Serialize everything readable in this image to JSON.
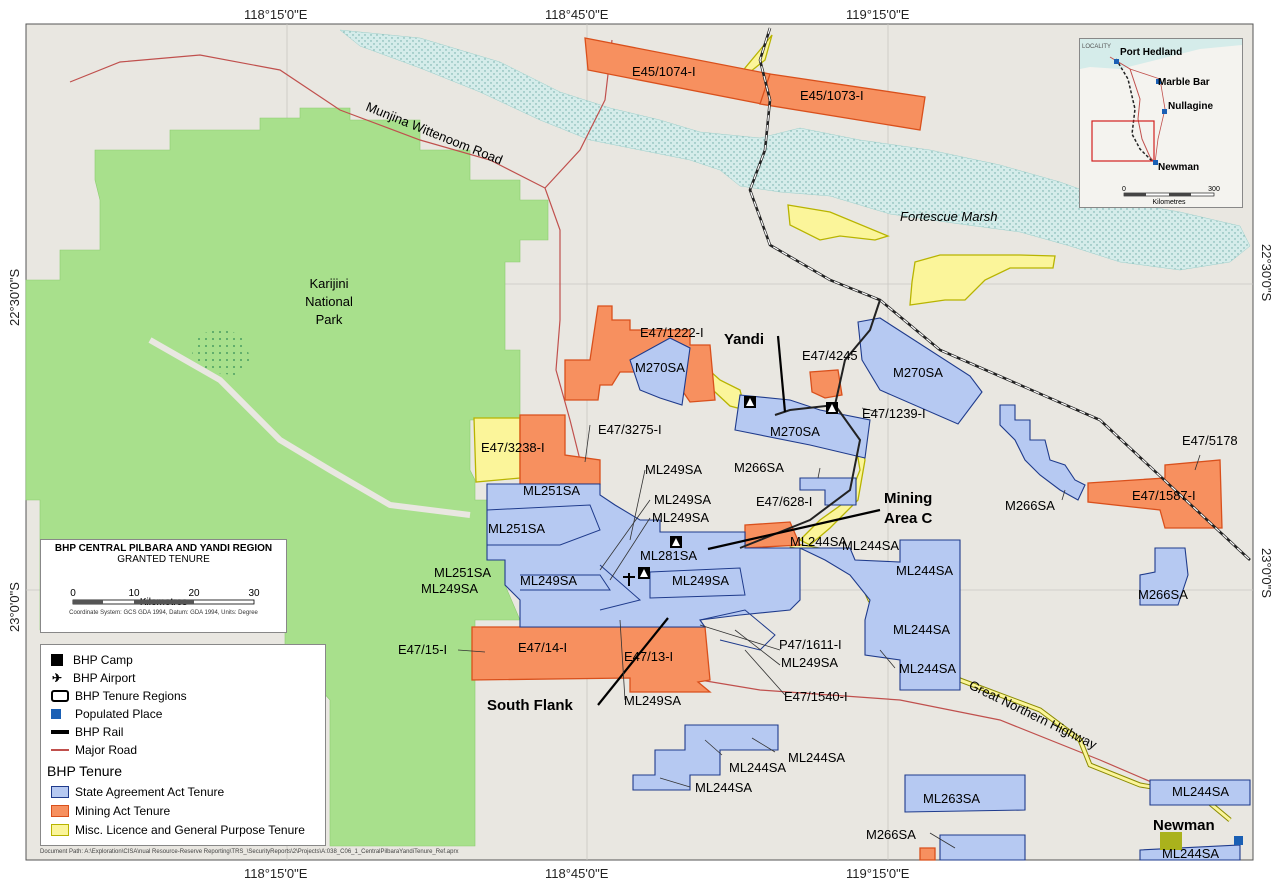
{
  "coords": {
    "top": [
      "118°15'0\"E",
      "118°45'0\"E",
      "119°15'0\"E"
    ],
    "bottom": [
      "118°15'0\"E",
      "118°45'0\"E",
      "119°15'0\"E"
    ],
    "left": [
      "22°30'0\"S",
      "23°0'0\"S"
    ],
    "right": [
      "22°30'0\"S",
      "23°0'0\"S"
    ]
  },
  "labels": {
    "karijini": [
      "Karijini",
      "National",
      "Park"
    ],
    "munjina_road": "Munjina Wittenoom Road",
    "fortescue": "Fortescue Marsh",
    "great_northern": "Great Northern Highway",
    "yandi": "Yandi",
    "mining_area_c": [
      "Mining",
      "Area C"
    ],
    "south_flank": "South Flank",
    "newman": "Newman"
  },
  "tenures": [
    {
      "text": "E45/1074-I"
    },
    {
      "text": "E45/1073-I"
    },
    {
      "text": "E47/1222-I"
    },
    {
      "text": "M270SA"
    },
    {
      "text": "E47/4245"
    },
    {
      "text": "M270SA"
    },
    {
      "text": "E47/1239-I"
    },
    {
      "text": "M270SA"
    },
    {
      "text": "E47/3275-I"
    },
    {
      "text": "E47/3238-I"
    },
    {
      "text": "ML249SA"
    },
    {
      "text": "M266SA"
    },
    {
      "text": "ML251SA"
    },
    {
      "text": "ML249SA"
    },
    {
      "text": "ML249SA"
    },
    {
      "text": "E47/628-I"
    },
    {
      "text": "ML251SA"
    },
    {
      "text": "ML281SA"
    },
    {
      "text": "ML244SA"
    },
    {
      "text": "ML244SA"
    },
    {
      "text": "ML251SA"
    },
    {
      "text": "ML249SA"
    },
    {
      "text": "ML249SA"
    },
    {
      "text": "ML249SA"
    },
    {
      "text": "ML244SA"
    },
    {
      "text": "ML244SA"
    },
    {
      "text": "E47/15-I"
    },
    {
      "text": "E47/14-I"
    },
    {
      "text": "E47/13-I"
    },
    {
      "text": "P47/1611-I"
    },
    {
      "text": "ML249SA"
    },
    {
      "text": "ML244SA"
    },
    {
      "text": "ML249SA"
    },
    {
      "text": "E47/1540-I"
    },
    {
      "text": "ML244SA"
    },
    {
      "text": "ML244SA"
    },
    {
      "text": "ML244SA"
    },
    {
      "text": "ML263SA"
    },
    {
      "text": "M266SA"
    },
    {
      "text": "ML244SA"
    },
    {
      "text": "ML244SA"
    },
    {
      "text": "E47/5178"
    },
    {
      "text": "E47/1587-I"
    },
    {
      "text": "M266SA"
    },
    {
      "text": "M266SA"
    }
  ],
  "title_box": {
    "title": "BHP CENTRAL PILBARA AND YANDI REGION",
    "subtitle": "GRANTED TENURE",
    "scale_ticks": [
      "0",
      "10",
      "20",
      "30"
    ],
    "scale_unit": "Kilometres",
    "crs": "Coordinate System: GCS GDA 1994, Datum: GDA 1994, Units: Degree"
  },
  "legend": {
    "items": [
      "BHP Camp",
      "BHP Airport",
      "BHP Tenure Regions",
      "Populated Place",
      "BHP Rail",
      "Major Road"
    ],
    "tenure_heading": "BHP Tenure",
    "tenure_items": [
      "State Agreement Act Tenure",
      "Mining Act Tenure",
      "Misc. Licence and General Purpose Tenure"
    ]
  },
  "inset": {
    "locality": "LOCALITY",
    "places": [
      "Port Hedland",
      "Marble Bar",
      "Nullagine",
      "Newman"
    ],
    "scale": [
      "0",
      "300"
    ],
    "unit": "Kilometres"
  },
  "colors": {
    "land": "#e9e7e1",
    "park": "#a8e08c",
    "marsh": "#d3ece9",
    "state": "#b6c9f2",
    "state_edge": "#1f3b8c",
    "mining": "#f7905f",
    "mining_edge": "#d9501c",
    "misc": "#fbf59a",
    "misc_edge": "#b8b400",
    "road": "#c0504d"
  },
  "doc_path": "Document Path: A:\\Exploration\\CISA\\nual Resource-Reserve Reporting\\TRS_\\SecurityReports\\2\\Projects\\A:038_C06_1_CentralPilbaraYandiTenure_Ref.aprx"
}
